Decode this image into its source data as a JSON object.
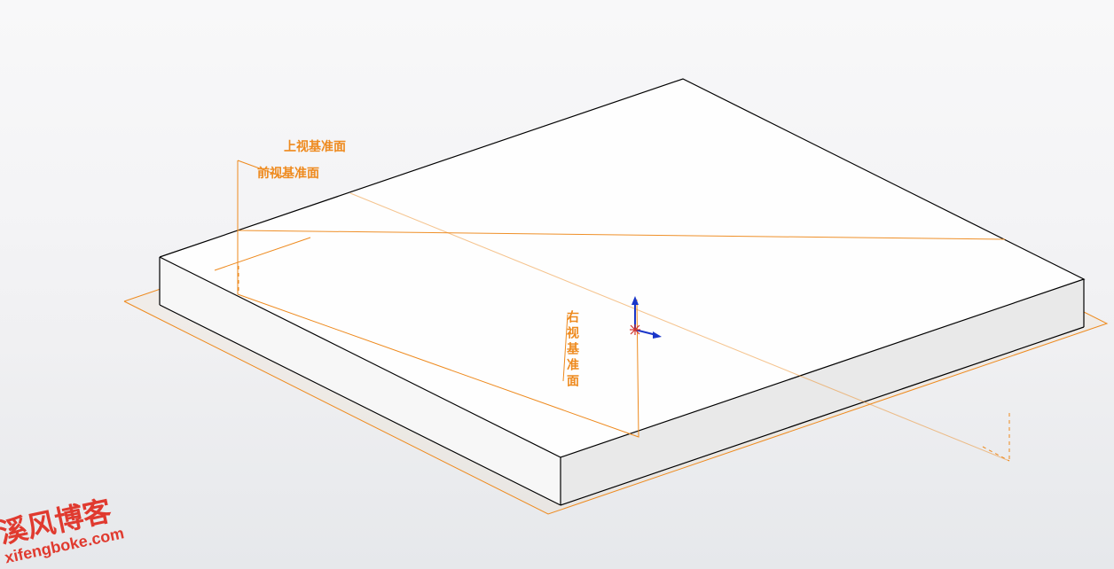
{
  "planes": {
    "top": {
      "label": "上视基准面"
    },
    "front": {
      "label": "前视基准面"
    },
    "right": {
      "label": "右视基准面"
    }
  },
  "watermark": {
    "title": "溪风博客",
    "url": "xifengboke.com"
  },
  "colors": {
    "plane": "#ee8a1e",
    "solid_edge": "#000000",
    "origin_blue": "#1a36c9",
    "origin_red": "#d1342c"
  }
}
